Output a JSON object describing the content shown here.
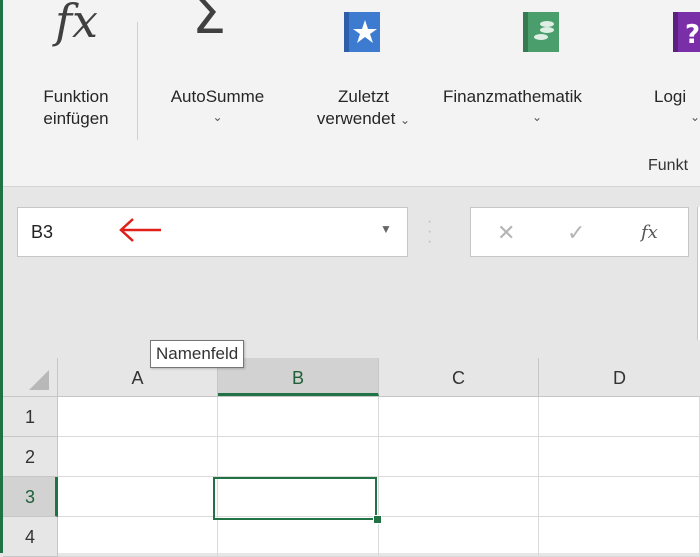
{
  "ribbon": {
    "insert_function": {
      "line1": "Funktion",
      "line2": "einfügen",
      "icon": "fx-icon"
    },
    "autosum": {
      "label": "AutoSumme",
      "chevron": "⌄",
      "icon": "sigma-icon"
    },
    "recently_used": {
      "line1": "Zuletzt",
      "line2": "verwendet",
      "chevron": "⌄",
      "icon": "star-book-icon"
    },
    "financial": {
      "label": "Finanzmathematik",
      "chevron": "⌄",
      "icon": "coins-book-icon"
    },
    "logical": {
      "label": "Logi",
      "chevron": "⌄",
      "icon": "question-book-icon"
    },
    "group_label": "Funkt",
    "colors": {
      "star_book": "#3d7bd0",
      "coins_book": "#4a9e6b",
      "question_book": "#7a2fa8"
    }
  },
  "name_box": {
    "value": "B3",
    "dropdown": "▼"
  },
  "annotation": {
    "arrow_color": "#e0201b"
  },
  "formula_controls": {
    "cancel": "✕",
    "enter": "✓",
    "fx": "fx"
  },
  "tooltip": {
    "text": "Namenfeld"
  },
  "sheet": {
    "columns": [
      "A",
      "B",
      "C",
      "D"
    ],
    "rows": [
      "1",
      "2",
      "3",
      "4"
    ],
    "active_cell": "B3",
    "accent": "#217346"
  }
}
